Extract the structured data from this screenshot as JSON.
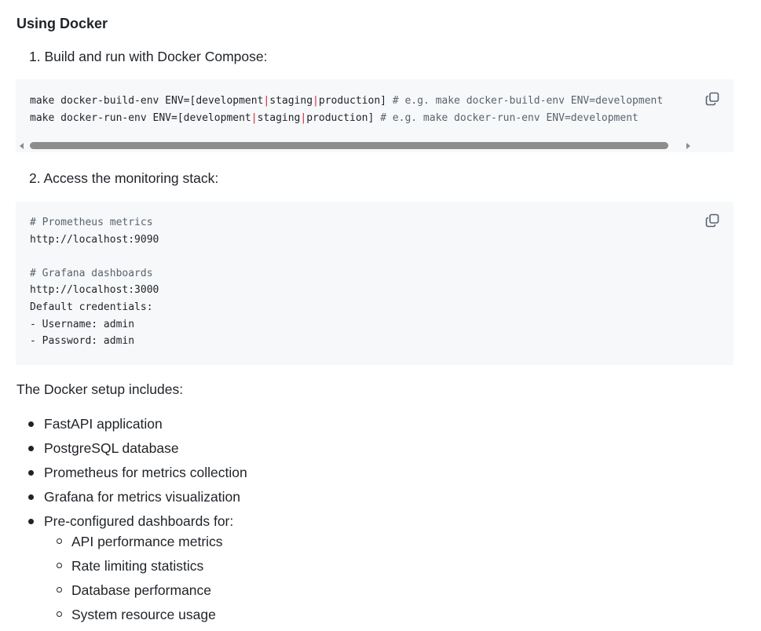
{
  "heading": "Using Docker",
  "step1": "1. Build and run with Docker Compose:",
  "code1": {
    "line1": {
      "cmd": "make docker-build-env ENV=[development",
      "sep1": "|",
      "mid": "staging",
      "sep2": "|",
      "end": "production]",
      "comment": " # e.g. make docker-build-env ENV=development"
    },
    "line2": {
      "cmd": "make docker-run-env ENV=[development",
      "sep1": "|",
      "mid": "staging",
      "sep2": "|",
      "end": "production]",
      "comment": " # e.g. make docker-run-env ENV=development"
    }
  },
  "step2": "2. Access the monitoring stack:",
  "code2": {
    "lines": [
      {
        "text": "# Prometheus metrics",
        "comment": true
      },
      {
        "text": "http://localhost:9090",
        "comment": false
      },
      {
        "text": "",
        "comment": false
      },
      {
        "text": "# Grafana dashboards",
        "comment": true
      },
      {
        "text": "http://localhost:3000",
        "comment": false
      },
      {
        "text": "Default credentials:",
        "comment": false
      },
      {
        "text": "- Username: admin",
        "comment": false
      },
      {
        "text": "- Password: admin",
        "comment": false
      }
    ]
  },
  "setup_intro": "The Docker setup includes:",
  "features": [
    "FastAPI application",
    "PostgreSQL database",
    "Prometheus for metrics collection",
    "Grafana for metrics visualization",
    "Pre-configured dashboards for:"
  ],
  "dashboards": [
    "API performance metrics",
    "Rate limiting statistics",
    "Database performance",
    "System resource usage"
  ],
  "icons": {
    "copy": "copy-icon",
    "scroll_left": "scroll-left-arrow-icon",
    "scroll_right": "scroll-right-arrow-icon"
  },
  "colors": {
    "code_bg": "#f6f8fa",
    "text": "#1f2328",
    "comment": "#59636e",
    "separator": "#d1242f"
  }
}
